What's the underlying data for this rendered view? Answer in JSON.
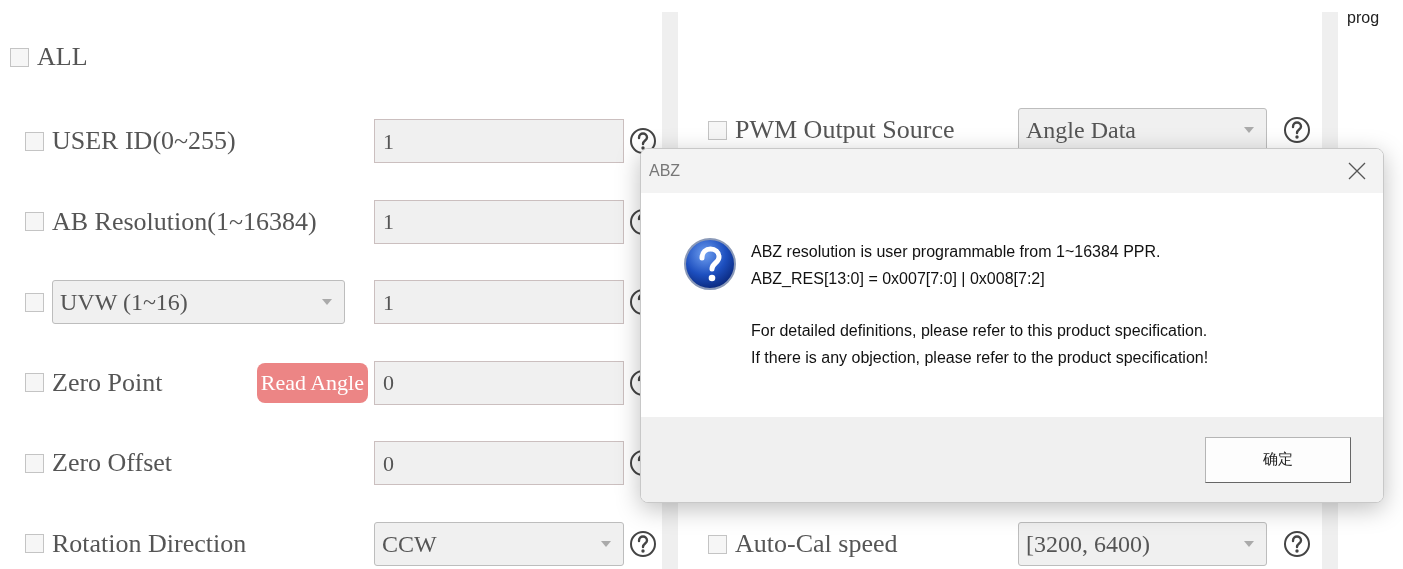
{
  "all": {
    "label": "ALL",
    "checked": false
  },
  "left_settings": [
    {
      "kind": "input",
      "label": "USER ID(0~255)",
      "checked": false,
      "value": "1"
    },
    {
      "kind": "input",
      "label": "AB Resolution(1~16384)",
      "checked": false,
      "value": "1"
    },
    {
      "kind": "select_label",
      "select": "UVW (1~16)",
      "checked": false,
      "value": "1"
    },
    {
      "kind": "button",
      "label": "Zero Point",
      "button": "Read Angle",
      "checked": false,
      "value": "0"
    },
    {
      "kind": "input",
      "label": "Zero Offset",
      "checked": false,
      "value": "0"
    },
    {
      "kind": "select",
      "label": "Rotation Direction",
      "checked": false,
      "value": "CCW"
    }
  ],
  "right_settings": [
    {
      "kind": "select",
      "label": "PWM Output Source",
      "checked": false,
      "value": "Angle Data"
    },
    {
      "kind": "select",
      "label": "Auto-Cal speed",
      "checked": false,
      "value": "[3200, 6400)"
    }
  ],
  "side_note": "prog",
  "dialog": {
    "title": "ABZ",
    "paragraphs": [
      [
        "ABZ resolution is user programmable from 1~16384 PPR.",
        "ABZ_RES[13:0] = 0x007[7:0] | 0x008[7:2]"
      ],
      [
        "For detailed definitions, please refer to this product specification.",
        "If there is any objection, please refer to the product specification!"
      ]
    ],
    "ok_button": "确定"
  }
}
